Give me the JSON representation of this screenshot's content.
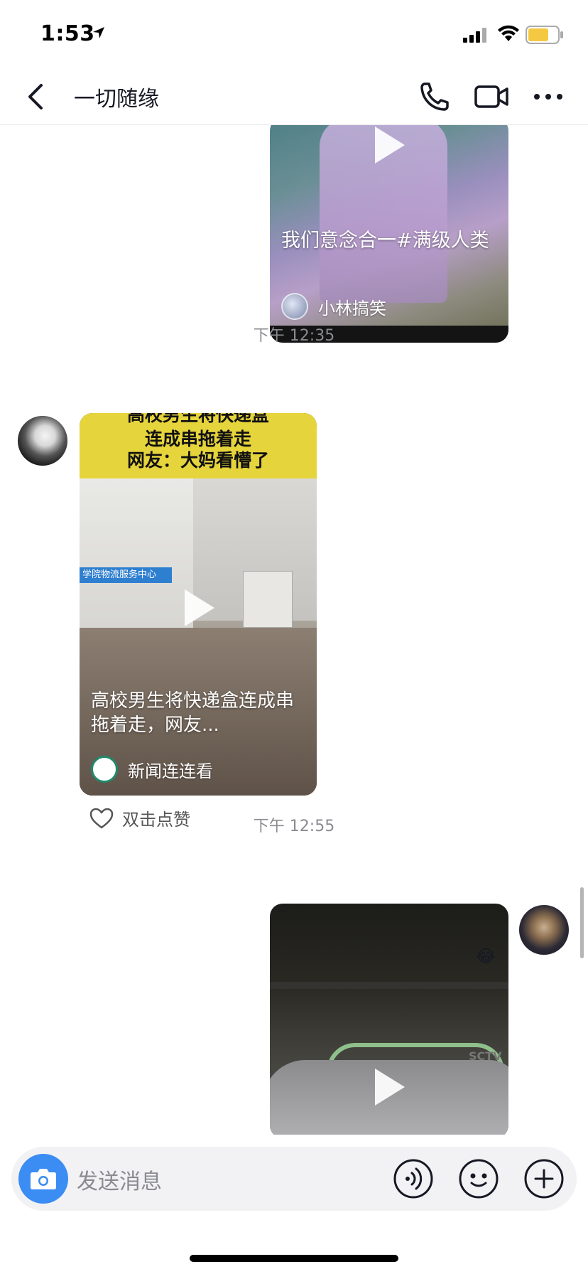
{
  "status_bar": {
    "time": "1:53"
  },
  "header": {
    "title": "一切随缘"
  },
  "messages": [
    {
      "type": "video",
      "side": "right",
      "caption": "我们意念合一#满级人类",
      "author": "小林搞笑"
    },
    {
      "type": "timestamp",
      "text": "下午 12:35"
    },
    {
      "type": "video",
      "side": "left",
      "banner": [
        "高校男生将快递盒",
        "连成串拖着走",
        "网友：大妈看懵了"
      ],
      "sign_text": "学院物流服务中心",
      "caption": "高校男生将快递盒连成串拖着走，网友...",
      "author": "新闻连连看",
      "like_text": "双击点赞"
    },
    {
      "type": "timestamp",
      "text": "下午 12:55"
    },
    {
      "type": "video",
      "side": "right",
      "emoji": "😂",
      "watermark": "SCTV"
    }
  ],
  "input_bar": {
    "placeholder": "发送消息"
  },
  "icons": [
    "location-arrow-icon",
    "signal-icon",
    "wifi-icon",
    "battery-icon",
    "back-icon",
    "phone-icon",
    "video-call-icon",
    "more-icon",
    "play-icon",
    "heart-icon",
    "camera-icon",
    "voice-icon",
    "emoji-icon",
    "plus-icon"
  ],
  "colors": {
    "accent": "#3b8cf3",
    "battery": "#f5c842",
    "banner": "#e6d43c"
  }
}
